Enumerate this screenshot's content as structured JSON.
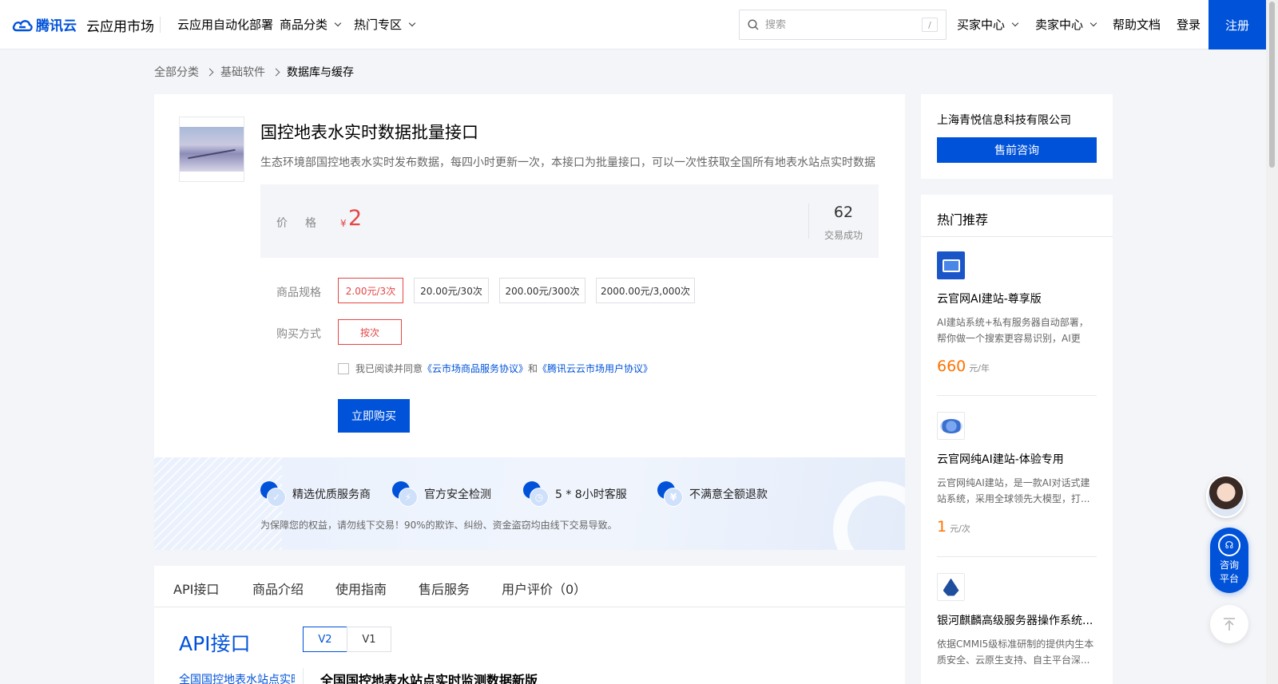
{
  "header": {
    "logo_text": "腾讯云",
    "market": "云应用市场",
    "nav": [
      "云应用自动化部署",
      "商品分类",
      "热门专区"
    ],
    "search_placeholder": "搜索",
    "search_shortcut": "/",
    "right_nav": [
      "买家中心",
      "卖家中心",
      "帮助文档",
      "登录"
    ],
    "register": "注册",
    "brand_color": "#0052d9"
  },
  "breadcrumb": [
    "全部分类",
    "基础软件",
    "数据库与缓存"
  ],
  "product": {
    "title": "国控地表水实时数据批量接口",
    "description": "生态环境部国控地表水实时发布数据，每四小时更新一次，本接口为批量接口，可以一次性获取全国所有地表水站点实时数据",
    "price_label": "价格",
    "currency": "¥",
    "price": "2",
    "deals": "62",
    "deals_label": "交易成功",
    "spec_label": "商品规格",
    "specs": [
      "2.00元/3次",
      "20.00元/30次",
      "200.00元/300次",
      "2000.00元/3,000次"
    ],
    "buy_mode_label": "购买方式",
    "buy_mode": "按次",
    "agree_prefix": "我已阅读并同意",
    "agree_link1": "《云市场商品服务协议》",
    "agree_and": "和",
    "agree_link2": "《腾讯云云市场用户协议》",
    "buy_button": "立即购买",
    "price_color": "#e54545"
  },
  "guarantee": {
    "items": [
      "精选优质服务商",
      "官方安全检测",
      "5 * 8小时客服",
      "不满意全额退款"
    ],
    "note": "为保障您的权益，请勿线下交易！90%的欺诈、纠纷、资金盗窃均由线下交易导致。"
  },
  "tabs": [
    "API接口",
    "商品介绍",
    "使用指南",
    "售后服务",
    "用户评价（0）"
  ],
  "api": {
    "title": "API接口",
    "versions": [
      "V2",
      "V1"
    ],
    "side_item": "全国国控地表水站点实时监测数据新版",
    "name": "全国国控地表水站点实时监测数据新版"
  },
  "vendor": {
    "name": "上海青悦信息科技有限公司",
    "consult": "售前咨询"
  },
  "hot": {
    "title": "热门推荐",
    "items": [
      {
        "name": "云官网AI建站-尊享版",
        "desc": "AI建站系统+私有服务器自动部署，帮你做一个搜索更容易识别，AI更容...",
        "price": "660",
        "unit": "元/年"
      },
      {
        "name": "云官网纯AI建站-体验专用",
        "desc": "云官网纯AI建站，是一款AI对话式建站系统，采用全球领先大模型，打...",
        "price": "1",
        "unit": "元/次"
      },
      {
        "name": "银河麒麟高级服务器操作系统...",
        "desc": "依据CMMI5级标准研制的提供内生本质安全、云原生支持、自主平台深...",
        "price": "",
        "unit": ""
      }
    ]
  },
  "float": {
    "consult_line1": "咨询",
    "consult_line2": "平台"
  }
}
